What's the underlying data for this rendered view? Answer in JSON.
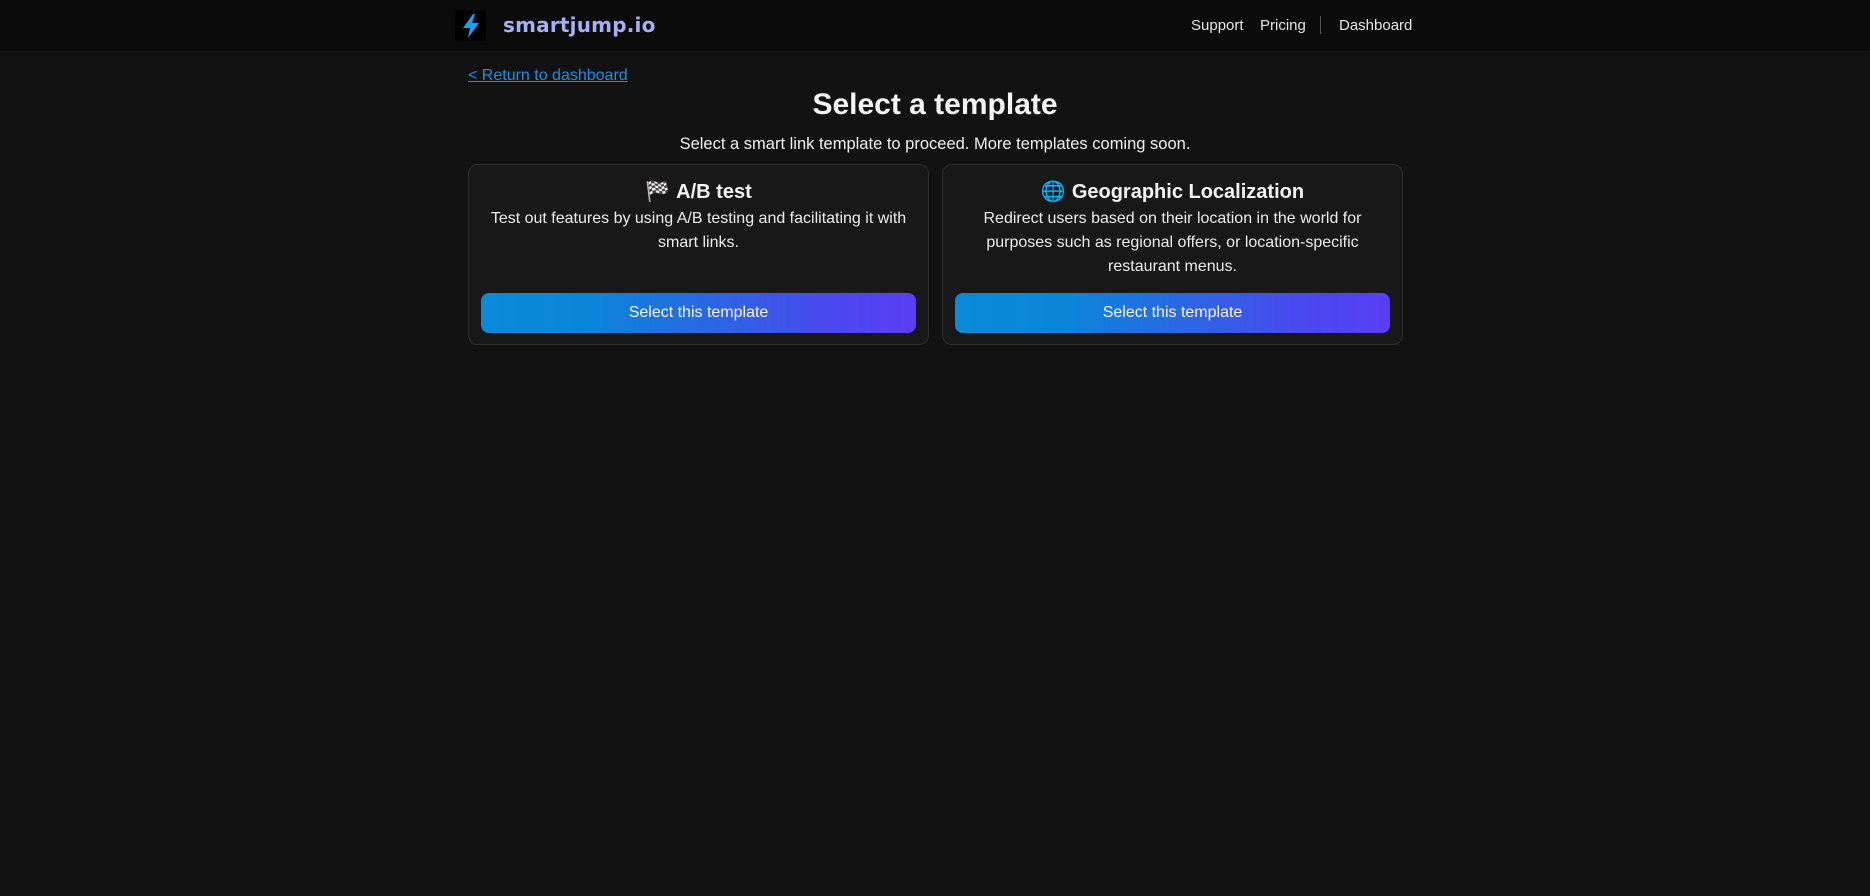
{
  "header": {
    "brand": "smartjump.io",
    "logo_icon": "lightning-bolt-icon",
    "nav": {
      "support": "Support",
      "pricing": "Pricing",
      "dashboard": "Dashboard"
    }
  },
  "back_link": "< Return to dashboard",
  "page": {
    "title": "Select a template",
    "subtitle": "Select a smart link template to proceed. More templates coming soon."
  },
  "templates": [
    {
      "emoji": "🏁",
      "title": "A/B test",
      "description": "Test out features by using A/B testing and facilitating it with smart links.",
      "button": "Select this template"
    },
    {
      "emoji": "🌐",
      "title": "Geographic Localization",
      "description": "Redirect users based on their location in the world for purposes such as regional offers, or location-specific restaurant menus.",
      "button": "Select this template"
    }
  ],
  "colors": {
    "background": "#121212",
    "topbar": "#0b0b0b",
    "brand": "#a7b0f5",
    "link": "#1c8fe3",
    "bolt": "#14a3f0",
    "button_gradient_start": "#0a8ad8",
    "button_gradient_end": "#5a3ef5"
  }
}
